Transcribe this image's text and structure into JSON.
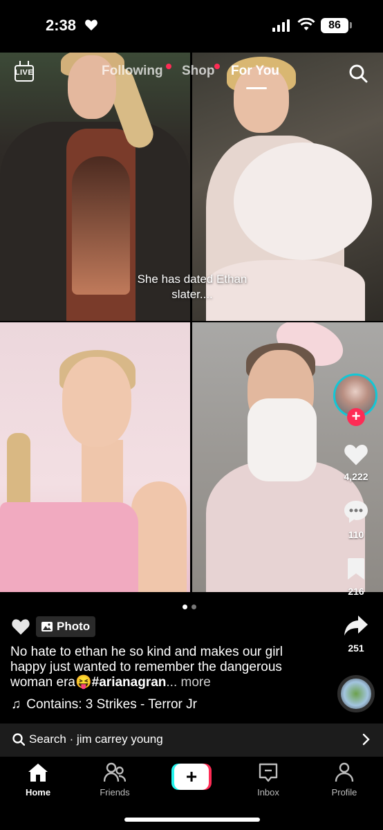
{
  "status_bar": {
    "time": "2:38",
    "battery": "86"
  },
  "top_nav": {
    "live_label": "LIVE",
    "tabs": [
      {
        "label": "Following",
        "has_dot": true
      },
      {
        "label": "Shop",
        "has_dot": true
      },
      {
        "label": "For You",
        "active": true
      }
    ]
  },
  "post": {
    "overlay_caption": "She has dated Ethan slater....",
    "badge_label": "Photo",
    "description": "No hate to ethan he so kind and makes our girl happy just wanted to remember the dangerous woman era",
    "emoji": "😝",
    "hashtag": "#arianagran",
    "more_label": "... more",
    "music": "Contains: 3 Strikes - Terror Jr",
    "page_index": 1,
    "page_count": 2
  },
  "actions": {
    "likes": "4,222",
    "comments": "110",
    "saves": "216",
    "shares": "251"
  },
  "search_bar": {
    "text": "Search · jim carrey young"
  },
  "bottom_nav": {
    "items": [
      {
        "label": "Home",
        "active": true
      },
      {
        "label": "Friends"
      },
      {
        "label": "Inbox"
      },
      {
        "label": "Profile"
      }
    ]
  },
  "colors": {
    "accent_red": "#fe2c55",
    "accent_cyan": "#25f4ee",
    "background": "#000000"
  },
  "icons": [
    "heart-icon",
    "signal-icon",
    "wifi-icon",
    "live-icon",
    "search-icon",
    "plus-icon",
    "like-heart-icon",
    "comment-icon",
    "bookmark-icon",
    "share-icon",
    "photo-icon",
    "music-note-icon",
    "chevron-right-icon",
    "home-icon",
    "friends-icon",
    "inbox-icon",
    "profile-icon"
  ]
}
